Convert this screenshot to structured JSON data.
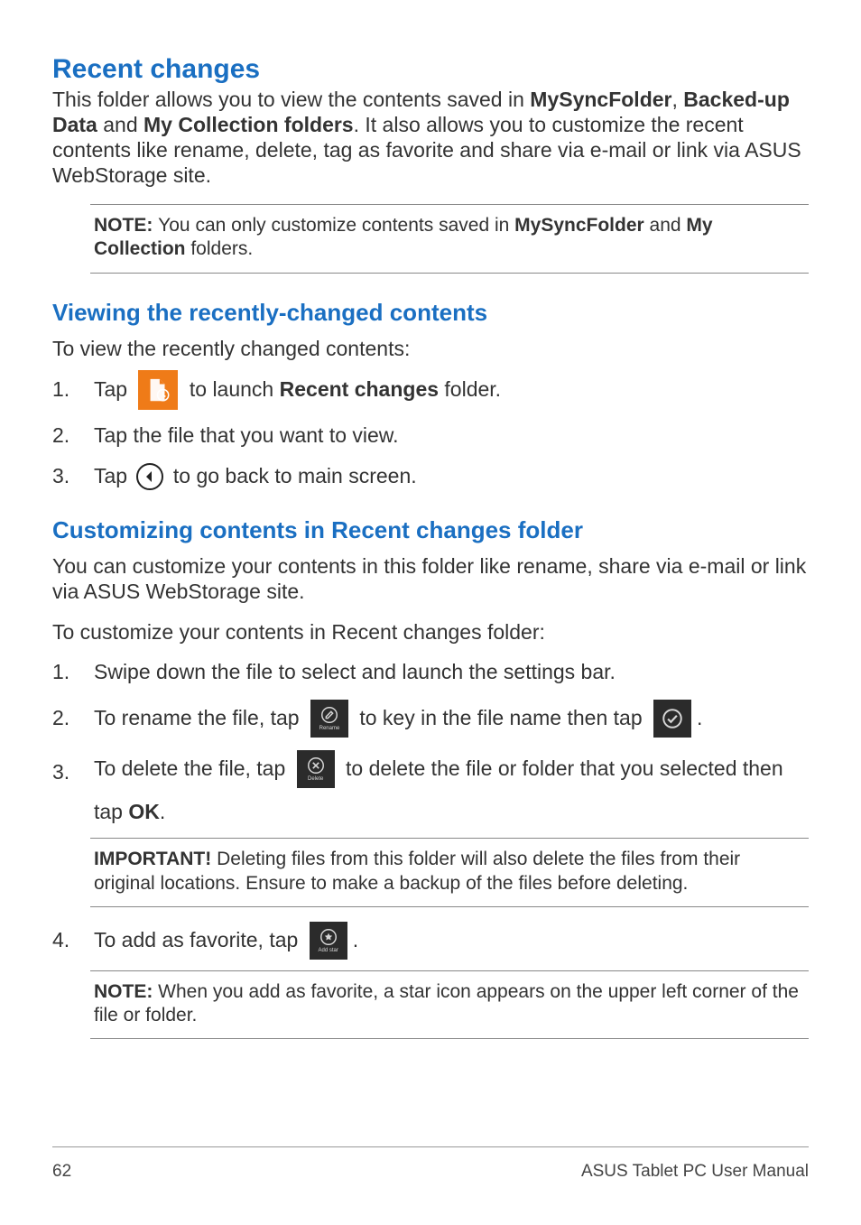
{
  "section1": {
    "title": "Recent changes",
    "intro_parts": {
      "p1": "This folder allows you to view the contents saved in ",
      "b1": "MySyncFolder",
      "p2": ", ",
      "b2": "Backed-up Data",
      "p3": " and ",
      "b3": "My Collection folders",
      "p4": ". It also allows you to customize the recent contents like rename, delete, tag as favorite and share via e-mail or link via ASUS WebStorage site."
    },
    "note": {
      "label": "NOTE:  ",
      "p1": "You can only customize contents saved in ",
      "b1": "MySyncFolder",
      "p2": " and ",
      "b2": "My Collection",
      "p3": " folders."
    }
  },
  "section2": {
    "title": "Viewing the recently-changed contents",
    "lead": "To view the recently changed contents:",
    "steps": {
      "s1": {
        "num": "1.",
        "pre": "Tap ",
        "post": " to launch ",
        "bold": "Recent changes",
        "tail": " folder."
      },
      "s2": {
        "num": "2.",
        "text": "Tap the file that you want to view."
      },
      "s3": {
        "num": "3.",
        "pre": "Tap ",
        "post": " to go back to main screen."
      }
    }
  },
  "section3": {
    "title": "Customizing contents in Recent changes folder",
    "lead1": "You can customize your contents in this folder like rename, share via e-mail or link via ASUS WebStorage site.",
    "lead2": "To customize your contents in Recent changes folder:",
    "steps": {
      "s1": {
        "num": "1.",
        "text": "Swipe down the file to select and launch the settings bar."
      },
      "s2": {
        "num": "2.",
        "pre": "To rename the file, tap ",
        "mid": " to key in the file name then tap ",
        "tail": "."
      },
      "s3": {
        "num": "3.",
        "pre": "To delete the file, tap ",
        "mid": " to delete the file or folder that you selected then tap ",
        "bold": "OK",
        "tail": "."
      },
      "s4": {
        "num": "4.",
        "pre": "To add as favorite, tap ",
        "tail": "."
      }
    },
    "important": {
      "label": "IMPORTANT!  ",
      "text": "Deleting files from this folder will also delete the files from their original locations. Ensure to make a backup of the files before deleting."
    },
    "note2": {
      "label": "NOTE:  ",
      "text": "When you add as favorite, a star icon appears on the upper left corner of the file or folder."
    }
  },
  "icons": {
    "rename_label": "Rename",
    "delete_label": "Delete",
    "addstar_label": "Add star"
  },
  "footer": {
    "page_num": "62",
    "doc_title": "ASUS Tablet PC User Manual"
  }
}
